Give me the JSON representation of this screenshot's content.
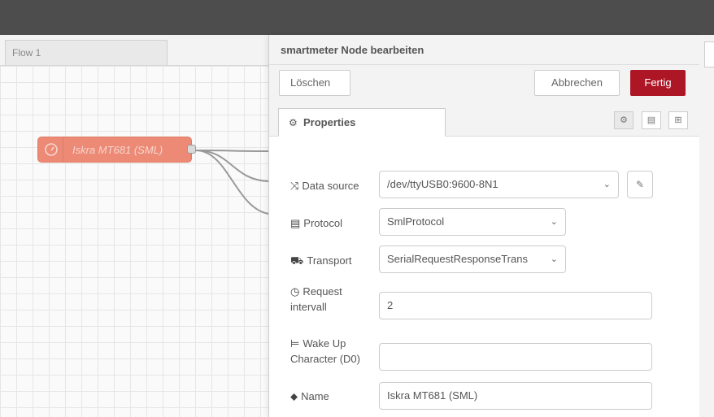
{
  "flow": {
    "tab_label": "Flow 1",
    "node": {
      "label": "Iskra MT681 (SML)",
      "icon": "gauge-icon",
      "color": "#ec8a76"
    }
  },
  "tray": {
    "title": "smartmeter Node bearbeiten",
    "buttons": {
      "delete": "Löschen",
      "cancel": "Abbrechen",
      "done": "Fertig"
    },
    "done_color": "#ad1625",
    "tabs": {
      "properties": "Properties",
      "icons": [
        "gear-icon",
        "description-icon",
        "appearance-icon"
      ]
    },
    "fields": {
      "data_source": {
        "label": "Data source",
        "icon": "shuffle-icon",
        "value": "/dev/ttyUSB0:9600-8N1"
      },
      "protocol": {
        "label": "Protocol",
        "icon": "file-icon",
        "value": "SmlProtocol"
      },
      "transport": {
        "label": "Transport",
        "icon": "truck-icon",
        "value": "SerialRequestResponseTrans"
      },
      "request_interval": {
        "label_line1": "Request",
        "label_line2": "intervall",
        "icon": "clock-icon",
        "value": "2"
      },
      "wake_up": {
        "label_line1": "Wake Up",
        "label_line2": "Character (D0)",
        "icon": "bed-icon",
        "value": ""
      },
      "name": {
        "label": "Name",
        "icon": "tag-icon",
        "value": "Iskra MT681 (SML)"
      }
    }
  }
}
